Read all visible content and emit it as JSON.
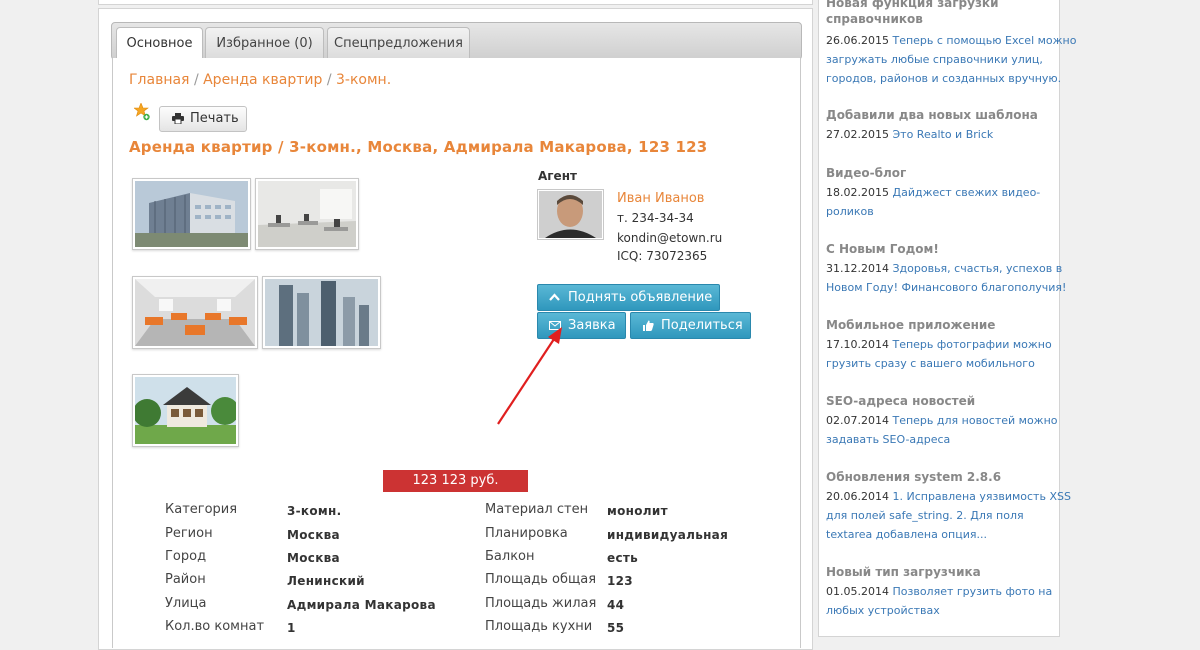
{
  "tabs": [
    "Основное",
    "Избранное (0)",
    "Спецпредложения"
  ],
  "breadcrumb": {
    "home": "Главная",
    "section": "Аренда квартир",
    "sep": "/",
    "current": "3-комн."
  },
  "print_label": "Печать",
  "listing_title": "Аренда квартир / 3-комн., Москва, Адмирала Макарова, 123 123",
  "photos": [
    "office-building-exterior",
    "office-interior",
    "open-office-orange",
    "skyscrapers",
    "country-house"
  ],
  "agent": {
    "label": "Агент",
    "name": "Иван Иванов",
    "phone": "т. 234-34-34",
    "email": "kondin@etown.ru",
    "icq": "ICQ: 73072365"
  },
  "buttons": {
    "raise": "Поднять объявление",
    "request": "Заявка",
    "share": "Поделиться"
  },
  "price": "123 123 руб.",
  "props_left": [
    {
      "key": "Категория",
      "value": "3-комн."
    },
    {
      "key": "Регион",
      "value": "Москва"
    },
    {
      "key": "Город",
      "value": "Москва"
    },
    {
      "key": "Район",
      "value": "Ленинский"
    },
    {
      "key": "Улица",
      "value": "Адмирала Макарова"
    },
    {
      "key": "Кол.во комнат",
      "value": "1"
    }
  ],
  "props_right": [
    {
      "key": "Материал стен",
      "value": "монолит"
    },
    {
      "key": "Планировка",
      "value": "индивидуальная"
    },
    {
      "key": "Балкон",
      "value": "есть"
    },
    {
      "key": "Площадь общая",
      "value": "123"
    },
    {
      "key": "Площадь жилая",
      "value": "44"
    },
    {
      "key": "Площадь кухни",
      "value": "55"
    }
  ],
  "news": [
    {
      "title": "Новая функция загрузки справочников",
      "lines": [
        {
          "date": "26.06.2015",
          "text": "Теперь с помощью Excel можно"
        },
        {
          "date": "",
          "text": "загружать любые справочники улиц,"
        },
        {
          "date": "",
          "text": "городов, районов и созданных вручную."
        }
      ]
    },
    {
      "title": "Добавили два новых шаблона",
      "lines": [
        {
          "date": "27.02.2015",
          "text": "Это Realto и Brick"
        }
      ]
    },
    {
      "title": "Видео-блог",
      "lines": [
        {
          "date": "18.02.2015",
          "text": "Дайджест свежих видео-"
        },
        {
          "date": "",
          "text": "роликов"
        }
      ]
    },
    {
      "title": "С Новым Годом!",
      "lines": [
        {
          "date": "31.12.2014",
          "text": "Здоровья, счастья, успехов в"
        },
        {
          "date": "",
          "text": "Новом Году! Финансового благополучия!"
        }
      ]
    },
    {
      "title": "Мобильное приложение",
      "lines": [
        {
          "date": "17.10.2014",
          "text": "Теперь фотографии можно"
        },
        {
          "date": "",
          "text": "грузить сразу с вашего мобильного"
        }
      ]
    },
    {
      "title": "SEO-адреса новостей",
      "lines": [
        {
          "date": "02.07.2014",
          "text": "Теперь для новостей можно"
        },
        {
          "date": "",
          "text": "задавать SEO-адреса"
        }
      ]
    },
    {
      "title": "Обновления system 2.8.6",
      "lines": [
        {
          "date": "20.06.2014",
          "text": "1. Исправлена уязвимость XSS"
        },
        {
          "date": "",
          "text": "для полей safe_string. 2. Для поля"
        },
        {
          "date": "",
          "text": "textarea добавлена опция..."
        }
      ]
    },
    {
      "title": "Новый тип загрузчика",
      "lines": [
        {
          "date": "01.05.2014",
          "text": "Позволяет грузить фото на"
        },
        {
          "date": "",
          "text": "любых устройствах"
        }
      ]
    }
  ],
  "colors": {
    "accent": "#e8863a",
    "button": "#2f97bd",
    "price": "#cc3333",
    "link": "#3a78b5"
  }
}
